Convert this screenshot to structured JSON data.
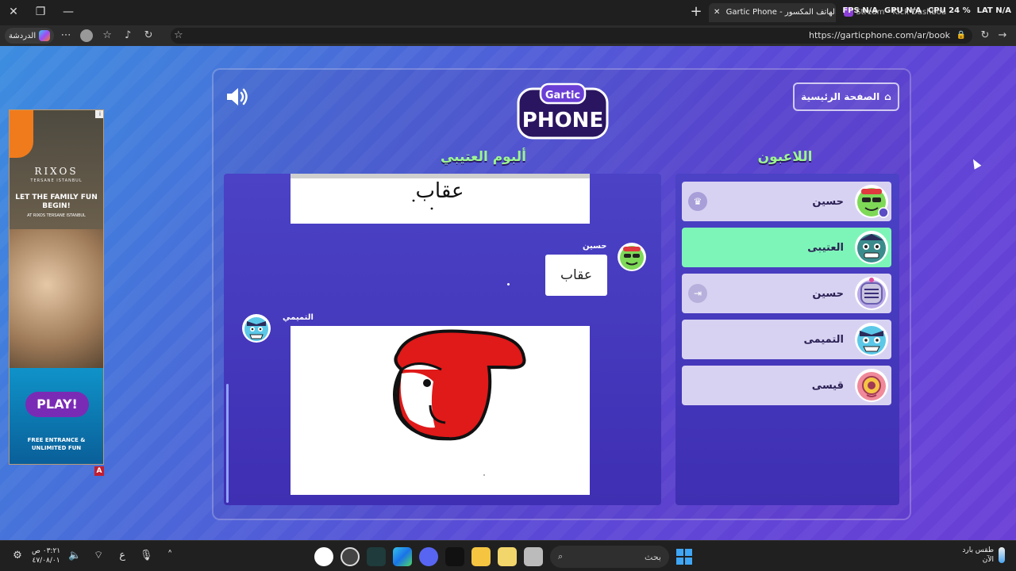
{
  "browser": {
    "active_tab_title": "Gartic Phone - لعبة الهاتف المكسور",
    "inactive_tab_title": "Stream - Kick Dashboard",
    "overlay": [
      "FPS N/A",
      "GPU N/A",
      "CPU 24 %",
      "LAT N/A"
    ],
    "copilot_label": "الدردشة",
    "url": "https://garticphone.com/ar/book"
  },
  "ad": {
    "brand": "RIXOS",
    "brand_sub": "TERSANE ISTANBUL",
    "headline": "LET THE FAMILY FUN BEGIN!",
    "at_text": "AT RIXOS TERSANE ISTANBUL",
    "play": "PLAY!",
    "cta": "FREE ENTRANCE & UNLIMITED FUN",
    "badge": "A"
  },
  "game": {
    "home_button": "الصفحة الرئيسية",
    "album_title": "ألبوم العتيبي",
    "players_title": "اللاعبون",
    "album": {
      "top_drawing_text": "عقاب",
      "guess_author": "حسين",
      "guess_text": "عقاب",
      "drawing_author": "التميمي"
    },
    "players": [
      {
        "name": "حسين",
        "tag": "crown-icon",
        "badge": "person"
      },
      {
        "name": "العتيبى",
        "tag": "",
        "me": true
      },
      {
        "name": "حسين",
        "tag": "exit-icon"
      },
      {
        "name": "التميمى",
        "tag": ""
      },
      {
        "name": "قيسى",
        "tag": ""
      }
    ]
  },
  "taskbar": {
    "time": "٠٣:٢١ ص",
    "date": "٤٧/٠٨/٠١",
    "lang": "ع",
    "search_placeholder": "بحث",
    "weather_line1": "طقس بارد",
    "weather_line2": "الآن"
  }
}
